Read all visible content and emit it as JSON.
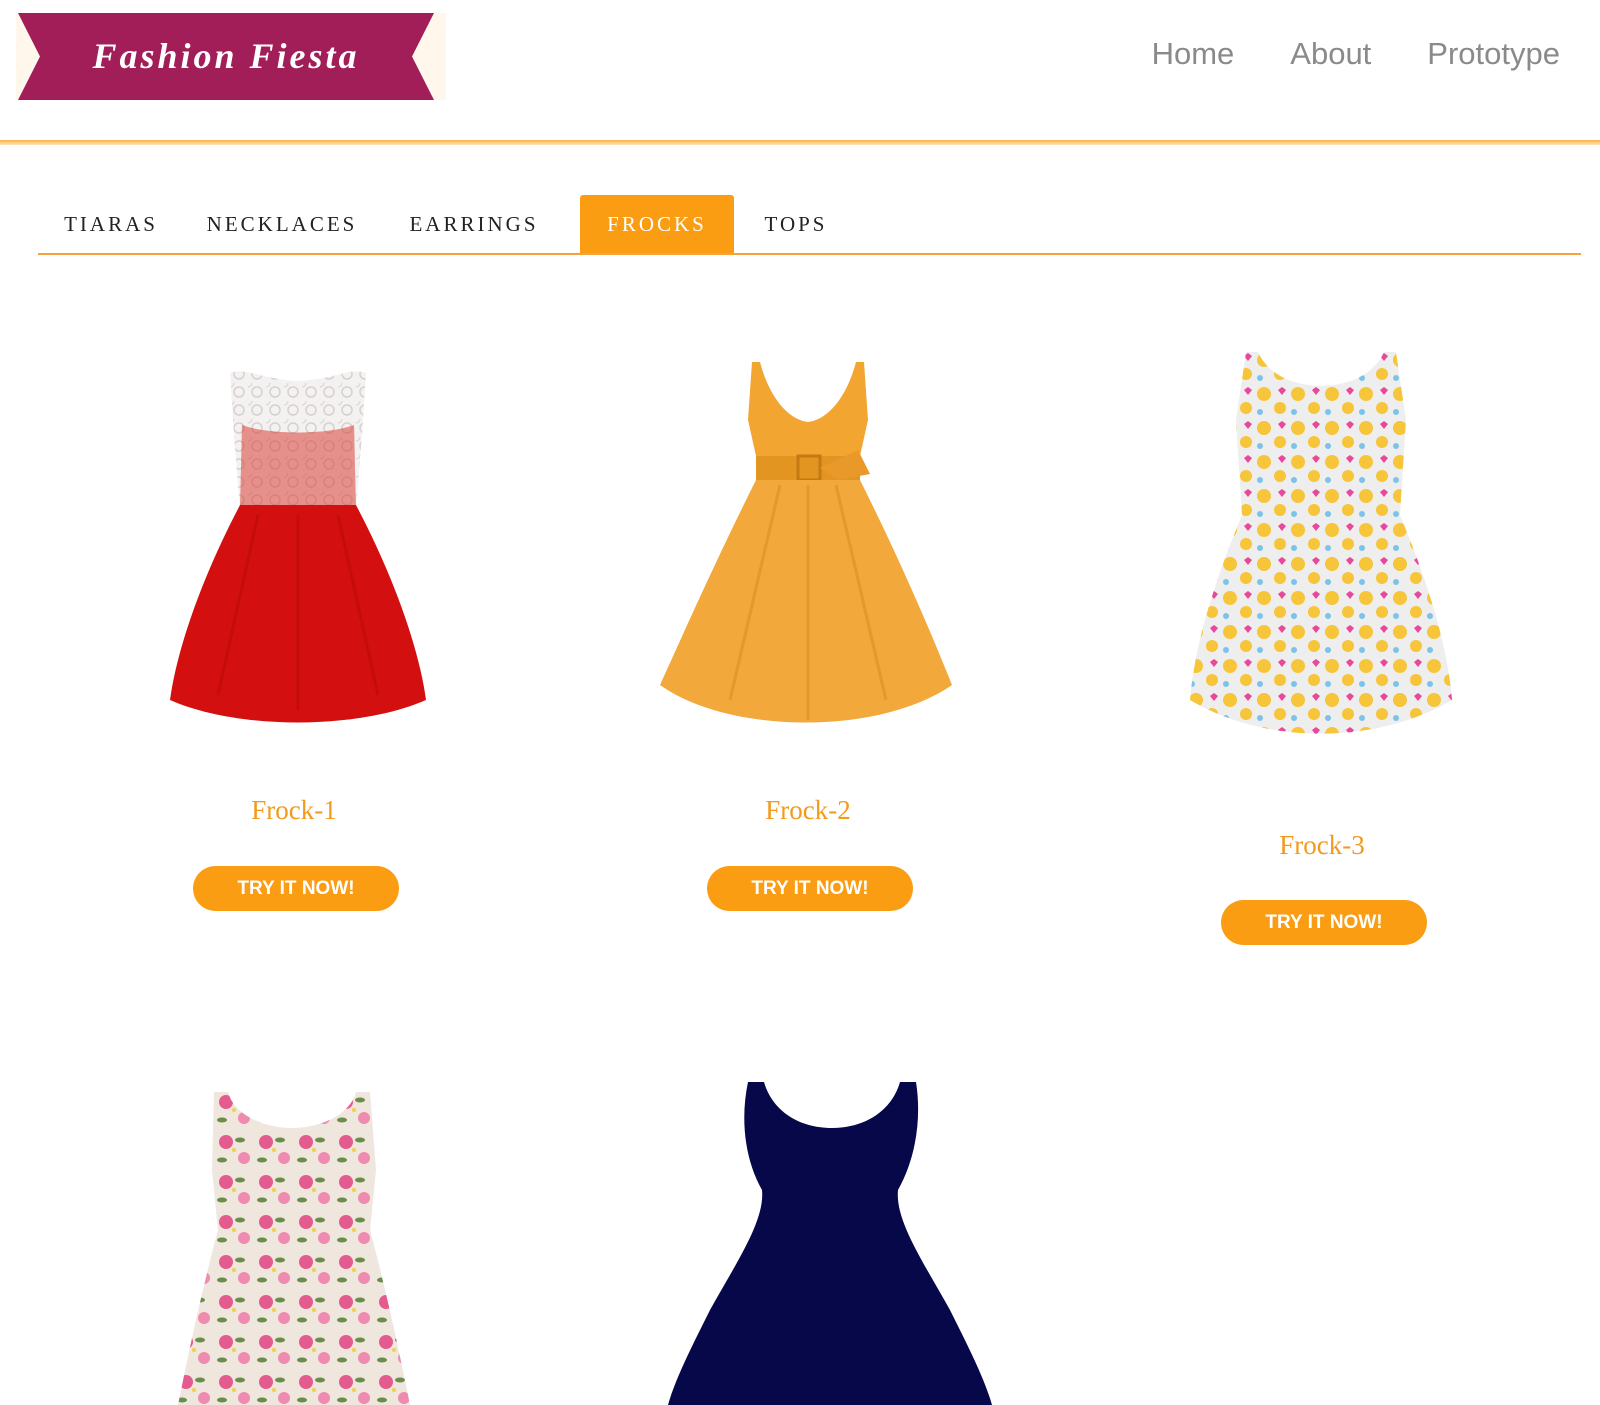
{
  "brand": {
    "name": "Fashion Fiesta",
    "banner_color": "#a11e58"
  },
  "nav": {
    "items": [
      "Home",
      "About",
      "Prototype"
    ]
  },
  "tabs": {
    "items": [
      "TIARAS",
      "NECKLACES",
      "EARRINGS",
      "FROCKS",
      "TOPS"
    ],
    "active": "FROCKS"
  },
  "colors": {
    "accent": "#fb9d13",
    "product_name": "#f39a1c"
  },
  "products": [
    {
      "name": "Frock-1",
      "button": "TRY IT NOW!",
      "image": "red-lace-frock"
    },
    {
      "name": "Frock-2",
      "button": "TRY IT NOW!",
      "image": "mustard-belted-frock"
    },
    {
      "name": "Frock-3",
      "button": "TRY IT NOW!",
      "image": "emoji-print-frock"
    },
    {
      "image": "floral-print-frock"
    },
    {
      "image": "navy-silhouette-frock"
    }
  ]
}
